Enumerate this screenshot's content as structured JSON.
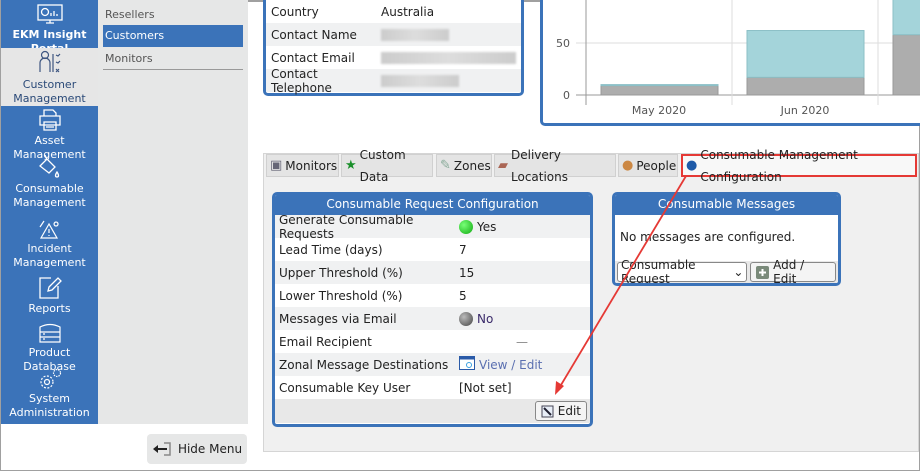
{
  "sidebar": {
    "items": [
      {
        "label": "EKM Insight Portal",
        "icon": "dashboard-monitor-icon"
      },
      {
        "label": "Customer Management",
        "icon": "customer-checklist-icon",
        "active": true
      },
      {
        "label": "Asset Management",
        "icon": "printer-icon"
      },
      {
        "label": "Consumable Management",
        "icon": "paint-bucket-icon"
      },
      {
        "label": "Incident Management",
        "icon": "warning-gear-icon"
      },
      {
        "label": "Reports",
        "icon": "edit-square-icon"
      },
      {
        "label": "Product Database",
        "icon": "server-stack-icon"
      },
      {
        "label": "System Administration",
        "icon": "gears-icon"
      }
    ]
  },
  "submenu": {
    "items": [
      {
        "label": "Resellers"
      },
      {
        "label": "Customers",
        "selected": true
      },
      {
        "label": "Monitors"
      }
    ]
  },
  "hide_menu": "Hide Menu",
  "contact": {
    "rows": [
      {
        "label": "Country",
        "value": "Australia"
      },
      {
        "label": "Contact Name",
        "value": ""
      },
      {
        "label": "Contact Email",
        "value": ""
      },
      {
        "label": "Contact Telephone",
        "value": ""
      }
    ]
  },
  "chart_data": {
    "type": "bar",
    "stacked": true,
    "categories": [
      "May 2020",
      "Jun 2020",
      ""
    ],
    "yticks": [
      0,
      50
    ],
    "series": [
      {
        "color": "#adadad",
        "values": [
          9,
          17,
          58
        ]
      },
      {
        "color": "#a4d4da",
        "values": [
          1,
          45,
          40
        ]
      }
    ]
  },
  "tabs": [
    {
      "label": "Monitors",
      "icon": "monitor-icon"
    },
    {
      "label": "Custom Data",
      "icon": "star-icon"
    },
    {
      "label": "Zones",
      "icon": "map-icon"
    },
    {
      "label": "Delivery Locations",
      "icon": "truck-icon"
    },
    {
      "label": "People",
      "icon": "people-icon"
    },
    {
      "label": "Consumable Management Configuration",
      "icon": "droplet-icon",
      "active": true
    }
  ],
  "request_config": {
    "title": "Consumable Request Configuration",
    "rows": [
      {
        "label": "Generate Consumable Requests",
        "value": "Yes",
        "status": "green"
      },
      {
        "label": "Lead Time (days)",
        "value": "7"
      },
      {
        "label": "Upper Threshold (%)",
        "value": "15"
      },
      {
        "label": "Lower Threshold (%)",
        "value": "5"
      },
      {
        "label": "Messages via Email",
        "value": "No",
        "status": "gray"
      },
      {
        "label": "Email Recipient",
        "value": "—"
      },
      {
        "label": "Zonal Message Destinations",
        "value": "View / Edit",
        "link": true
      },
      {
        "label": "Consumable Key User",
        "value": "[Not set]"
      }
    ],
    "edit_label": "Edit"
  },
  "messages": {
    "title": "Consumable Messages",
    "empty": "No messages are configured.",
    "select_value": "Consumable Request",
    "add_label": "Add / Edit"
  },
  "colors": {
    "accent": "#3b73b9",
    "highlight": "#e53935"
  }
}
